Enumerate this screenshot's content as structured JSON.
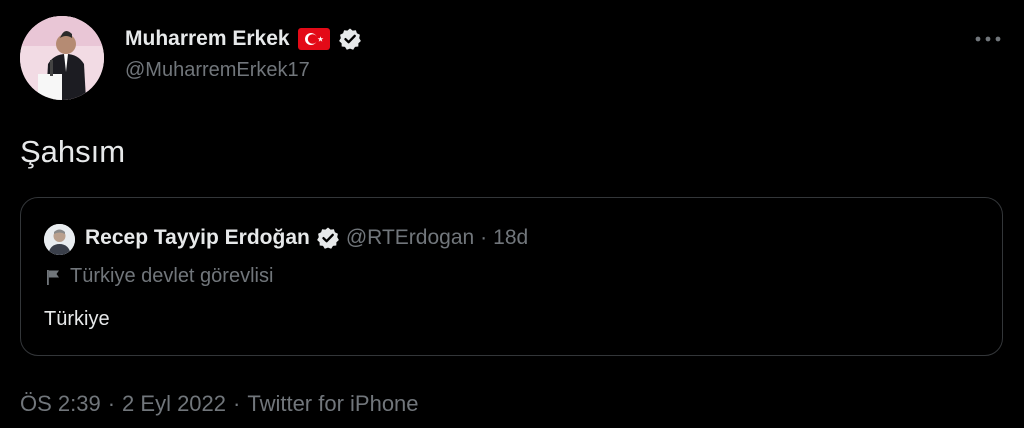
{
  "tweet": {
    "author": {
      "name": "Muharrem Erkek",
      "handle": "@MuharremErkek17",
      "flag_icon": "turkey-flag-icon",
      "verified_icon": "verified-badge-icon"
    },
    "more_icon": "more-options-icon",
    "text": "Şahsım",
    "quoted": {
      "name": "Recep Tayyip Erdoğan",
      "handle": "@RTErdogan",
      "separator": "·",
      "time": "18d",
      "label_icon": "flag-outline-icon",
      "label": "Türkiye devlet görevlisi",
      "text": "Türkiye"
    },
    "meta": {
      "time": "ÖS 2:39",
      "sep1": "·",
      "date": "2 Eyl 2022",
      "sep2": "·",
      "source": "Twitter for iPhone"
    }
  },
  "colors": {
    "background": "#000000",
    "text_primary": "#e7e9ea",
    "text_secondary": "#71767b",
    "border": "#333639",
    "flag_red": "#e30a17"
  }
}
